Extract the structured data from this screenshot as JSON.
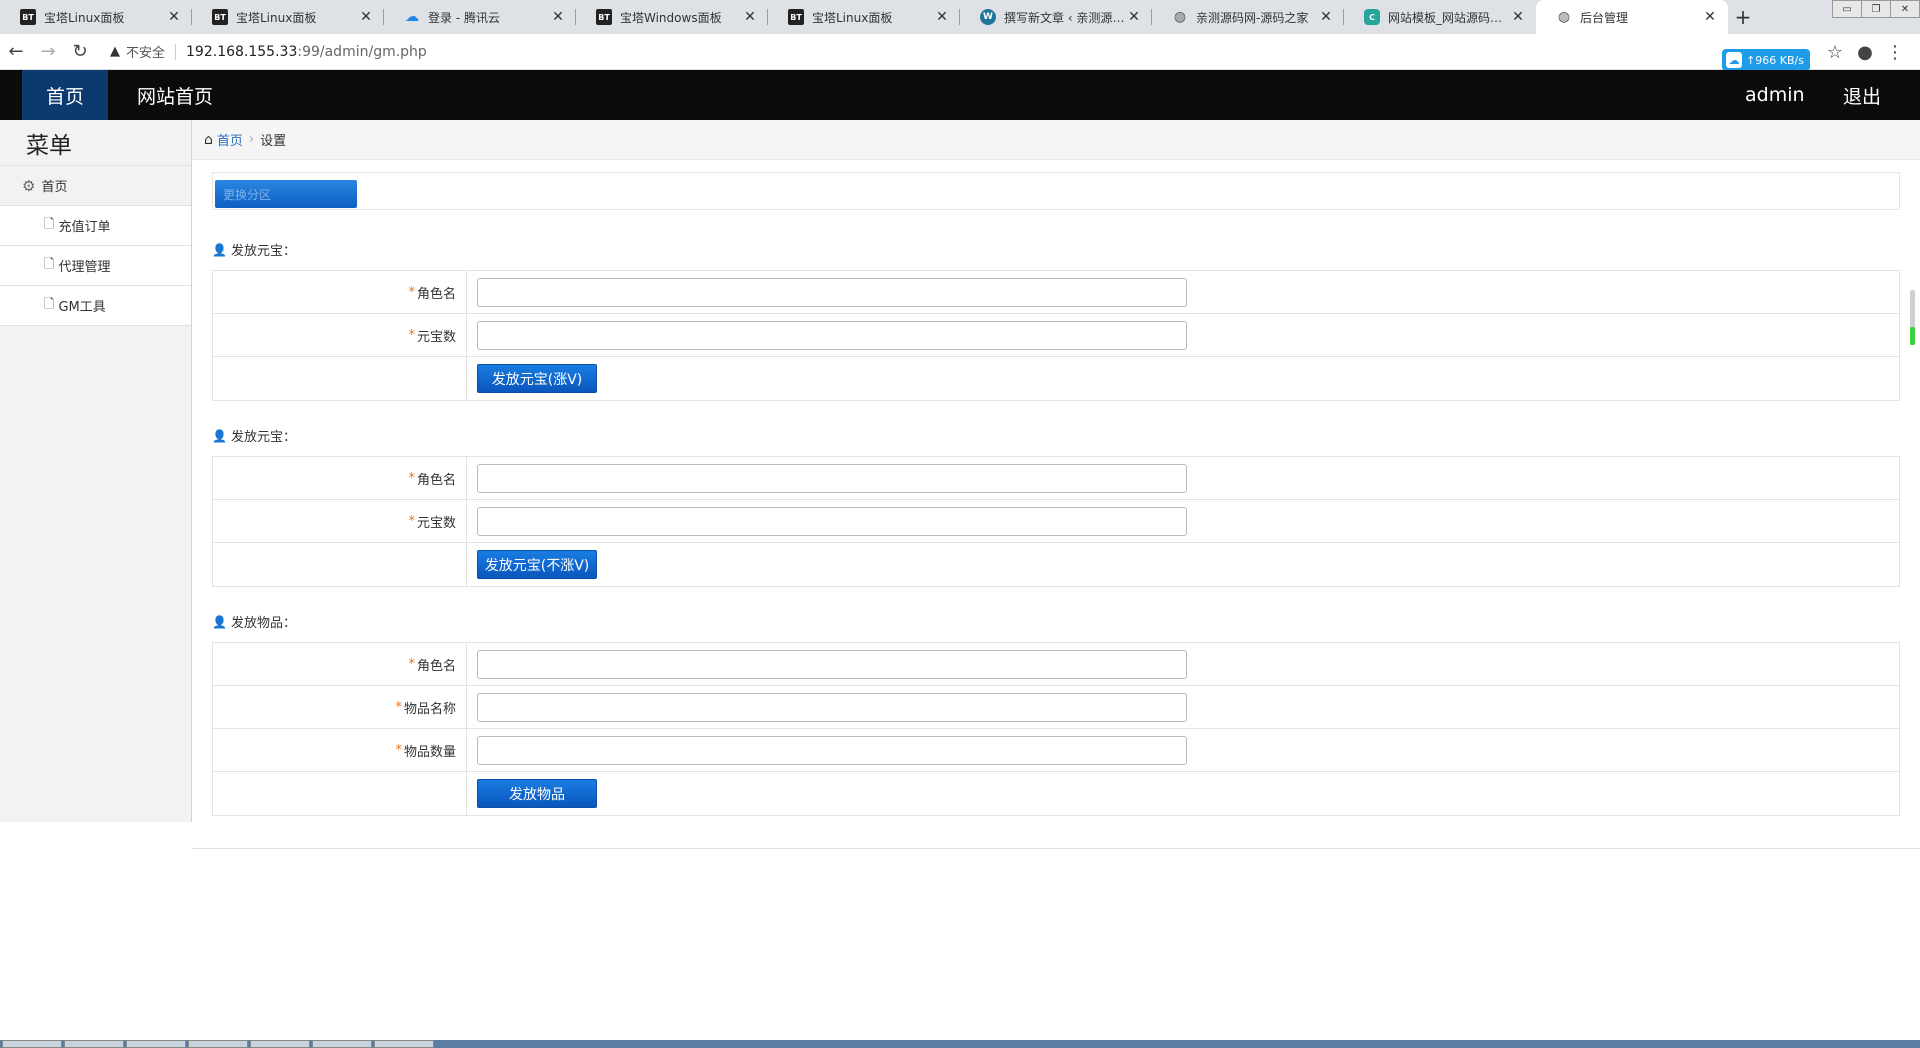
{
  "browser": {
    "tabs": [
      {
        "favicon": "BT",
        "fav_type": "bt",
        "title": "宝塔Linux面板"
      },
      {
        "favicon": "BT",
        "fav_type": "bt",
        "title": "宝塔Linux面板"
      },
      {
        "favicon": "☁",
        "fav_type": "cloud",
        "title": "登录 - 腾讯云"
      },
      {
        "favicon": "BT",
        "fav_type": "bt",
        "title": "宝塔Windows面板"
      },
      {
        "favicon": "BT",
        "fav_type": "bt",
        "title": "宝塔Linux面板"
      },
      {
        "favicon": "W",
        "fav_type": "wp",
        "title": "撰写新文章 ‹ 亲测源码网"
      },
      {
        "favicon": "◍",
        "fav_type": "globe",
        "title": "亲测源码网-源码之家"
      },
      {
        "favicon": "C",
        "fav_type": "green",
        "title": "网站模板_网站源码下载"
      },
      {
        "favicon": "◍",
        "fav_type": "globe",
        "title": "后台管理",
        "active": true
      }
    ],
    "close_glyph": "✕",
    "new_tab_glyph": "+",
    "window_controls": [
      "▭",
      "❐",
      "✕"
    ],
    "back_glyph": "←",
    "forward_glyph": "→",
    "reload_glyph": "↻",
    "warning_glyph": "▲",
    "insecure_label": "不安全",
    "url_host": "192.168.155.33",
    "url_path": ":99/admin/gm.php",
    "speed_label": "966 KB/s",
    "speed_glyph": "↑",
    "star_glyph": "☆",
    "profile_glyph": "●",
    "menu_glyph": "⋮"
  },
  "topnav": {
    "home": "首页",
    "site_home": "网站首页",
    "user": "admin",
    "logout": "退出"
  },
  "sidebar": {
    "title": "菜单",
    "group_label": "首页",
    "group_icon": "⚙",
    "item_icon": "🗋",
    "items": [
      {
        "label": "充值订单"
      },
      {
        "label": "代理管理"
      },
      {
        "label": "GM工具"
      }
    ]
  },
  "breadcrumb": {
    "home_icon": "⌂",
    "home": "首页",
    "separator": "›",
    "current": "设置"
  },
  "zone_select": {
    "value": "更换分区"
  },
  "sections": [
    {
      "title": "发放元宝：",
      "fields": [
        {
          "label": "角色名",
          "value": ""
        },
        {
          "label": "元宝数",
          "value": ""
        }
      ],
      "button": "发放元宝(涨V)"
    },
    {
      "title": "发放元宝：",
      "fields": [
        {
          "label": "角色名",
          "value": ""
        },
        {
          "label": "元宝数",
          "value": ""
        }
      ],
      "button": "发放元宝(不涨V)"
    },
    {
      "title": "发放物品：",
      "fields": [
        {
          "label": "角色名",
          "value": ""
        },
        {
          "label": "物品名称",
          "value": ""
        },
        {
          "label": "物品数量",
          "value": ""
        }
      ],
      "button": "发放物品"
    }
  ],
  "required_mark": "*",
  "section_icon": "👤",
  "colors": {
    "topnav_bg": "#0b0b0b",
    "active_nav": "#0c3a6e",
    "button_blue": "#0d6ad6",
    "required": "#e8741c",
    "link": "#2a6ebb"
  }
}
